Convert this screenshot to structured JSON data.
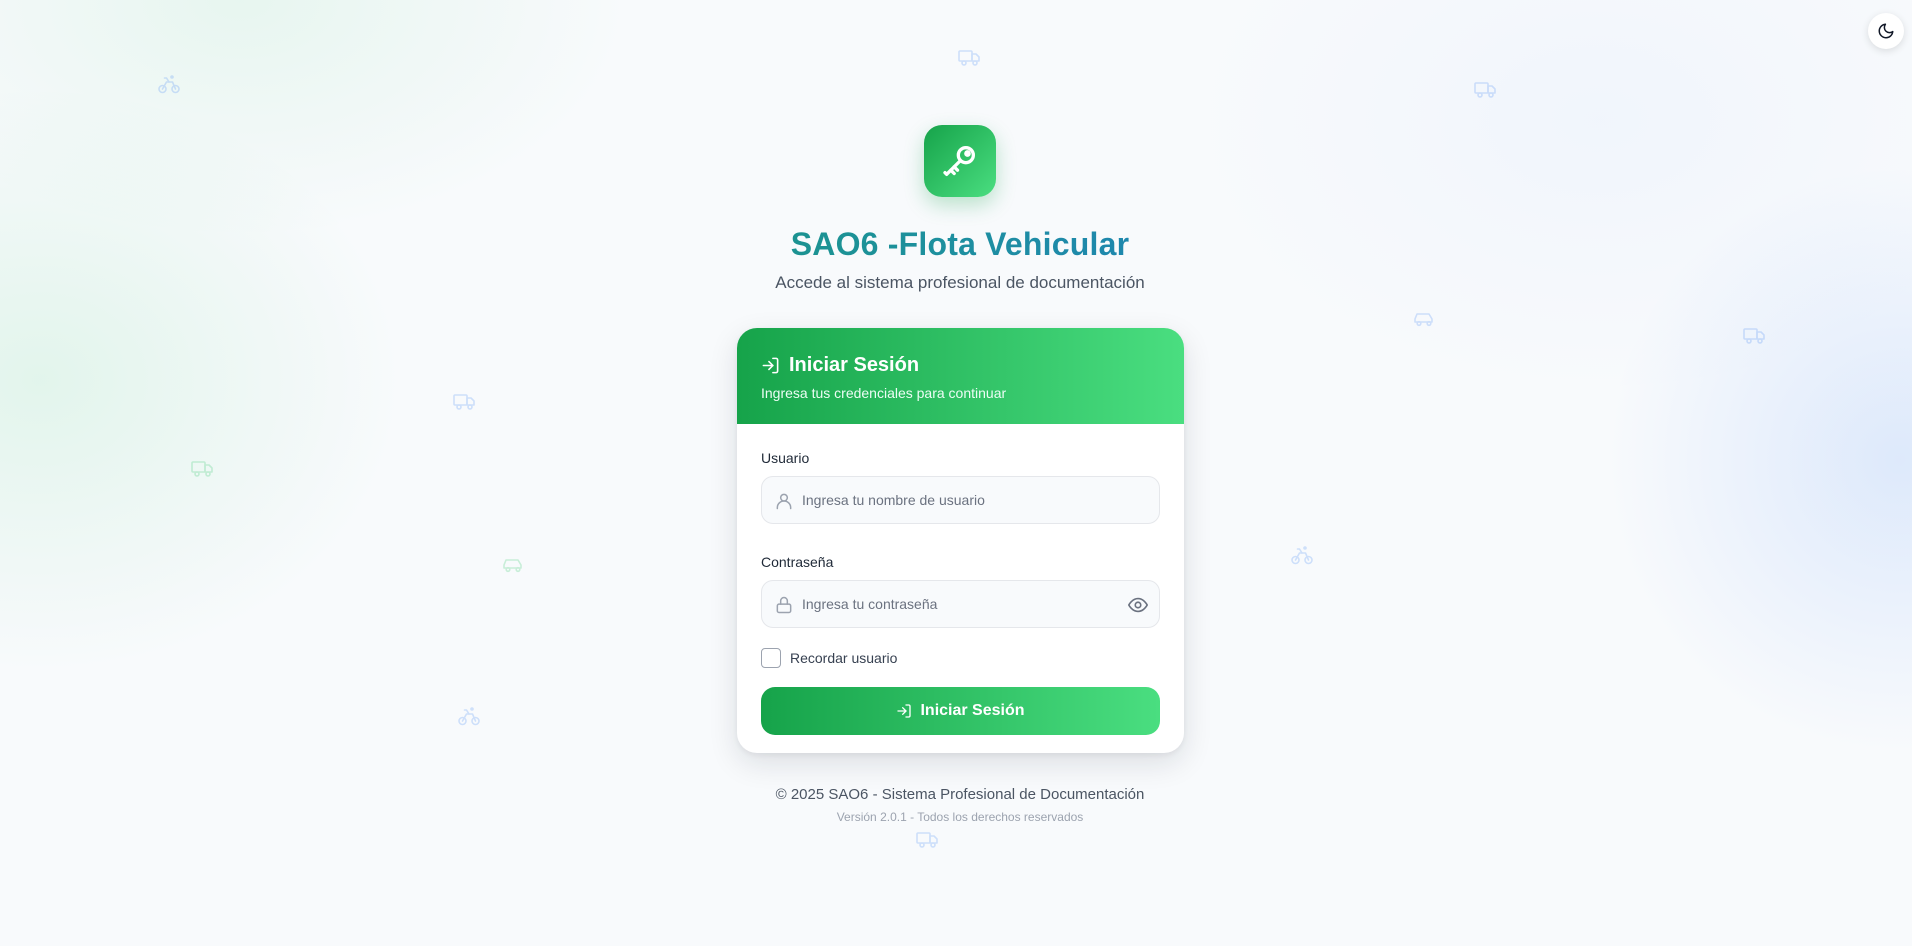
{
  "header": {
    "title_part1": "SAO6 - ",
    "title_part2": "Flota Vehicular",
    "subtitle": "Accede al sistema profesional de documentación"
  },
  "login_card": {
    "title": "Iniciar Sesión",
    "subtitle": "Ingresa tus credenciales para continuar",
    "username_label": "Usuario",
    "username_placeholder": "Ingresa tu nombre de usuario",
    "username_value": "",
    "password_label": "Contraseña",
    "password_placeholder": "Ingresa tu contraseña",
    "password_value": "",
    "remember_label": "Recordar usuario",
    "remember_checked": false,
    "submit_label": "Iniciar Sesión"
  },
  "footer": {
    "copyright": "© 2025 SAO6 - Sistema Profesional de Documentación",
    "version": "Versión 2.0.1 - Todos los derechos reservados"
  },
  "icons": {
    "theme_toggle": "moon-icon",
    "logo": "key-icon",
    "login": "log-in-icon",
    "username": "user-icon",
    "password": "lock-icon",
    "password_visibility": "eye-icon",
    "background": [
      "truck-icon",
      "bike-icon",
      "car-icon"
    ]
  },
  "colors": {
    "primary_green": "#16a34a",
    "light_green": "#4ade80",
    "title_blue": "#2563eb"
  }
}
